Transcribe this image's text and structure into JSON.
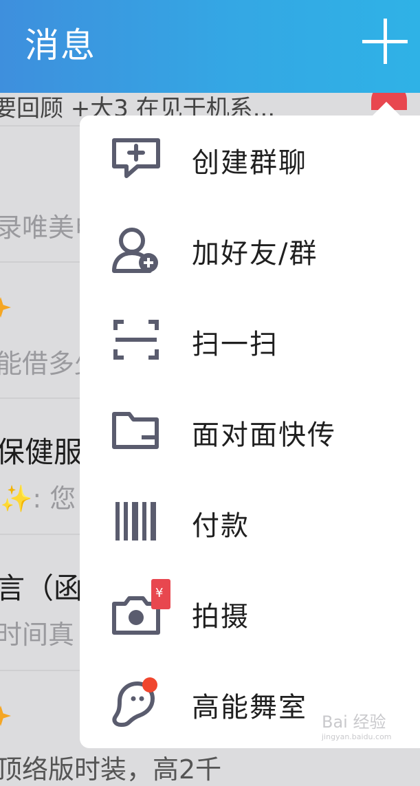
{
  "header": {
    "title": "消息",
    "add_icon": "plus-icon"
  },
  "background_list": [
    {
      "secondary": "要回顾 +大3 在见干机系..."
    },
    {
      "secondary": "录唯美电"
    },
    {
      "secondary": "能借多少"
    },
    {
      "primary": "保健服",
      "secondary": "✨: 您"
    },
    {
      "primary": "言（函",
      "secondary": "时间真"
    },
    {
      "secondary": "顶络版时装，高2千"
    }
  ],
  "menu": {
    "items": [
      {
        "label": "创建群聊",
        "icon": "chat-add-icon"
      },
      {
        "label": "加好友/群",
        "icon": "add-friend-icon"
      },
      {
        "label": "扫一扫",
        "icon": "scan-icon"
      },
      {
        "label": "面对面快传",
        "icon": "folder-transfer-icon"
      },
      {
        "label": "付款",
        "icon": "barcode-icon"
      },
      {
        "label": "拍摄",
        "icon": "camera-icon",
        "badge": "¥"
      },
      {
        "label": "高能舞室",
        "icon": "dance-ghost-icon"
      }
    ]
  },
  "watermark": {
    "text": "Bai 经验",
    "sub": "jingyan.baidu.com"
  },
  "colors": {
    "header": "#34a7e4",
    "icon": "#5a5c6e",
    "badge": "#e8474f"
  }
}
